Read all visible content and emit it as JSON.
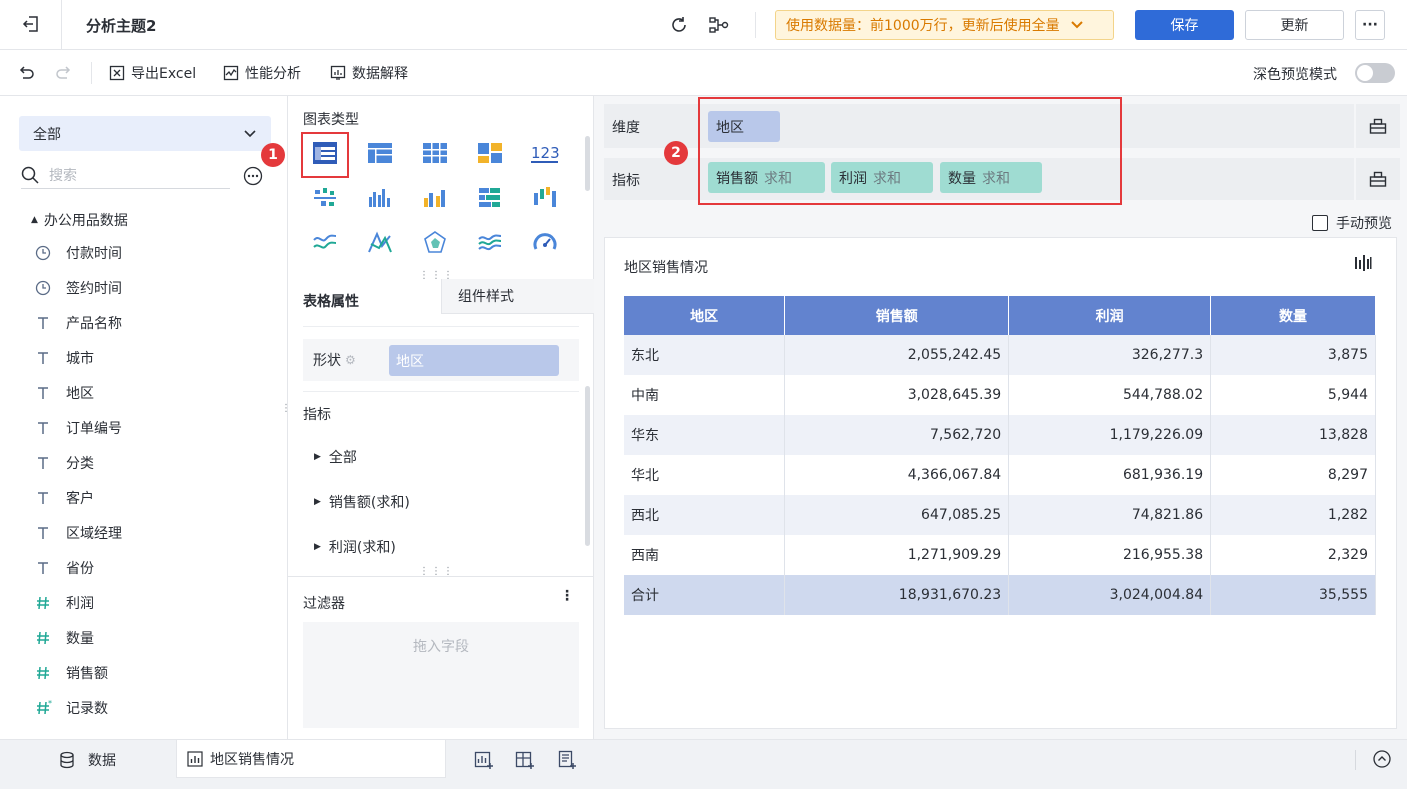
{
  "header": {
    "title": "分析主题2",
    "data_notice": "使用数据量：前1000万行，更新后使用全量",
    "save_label": "保存",
    "update_label": "更新",
    "more_label": "···"
  },
  "toolbar": {
    "export_label": "导出Excel",
    "performance_label": "性能分析",
    "explain_label": "数据解释",
    "dark_mode_label": "深色预览模式"
  },
  "left": {
    "dataset_select": "全部",
    "search_placeholder": "搜索",
    "folder": "办公用品数据",
    "fields": [
      {
        "name": "付款时间",
        "type": "time"
      },
      {
        "name": "签约时间",
        "type": "time"
      },
      {
        "name": "产品名称",
        "type": "text"
      },
      {
        "name": "城市",
        "type": "text"
      },
      {
        "name": "地区",
        "type": "text"
      },
      {
        "name": "订单编号",
        "type": "text"
      },
      {
        "name": "分类",
        "type": "text"
      },
      {
        "name": "客户",
        "type": "text"
      },
      {
        "name": "区域经理",
        "type": "text"
      },
      {
        "name": "省份",
        "type": "text"
      },
      {
        "name": "利润",
        "type": "number"
      },
      {
        "name": "数量",
        "type": "number"
      },
      {
        "name": "销售额",
        "type": "number"
      },
      {
        "name": "记录数",
        "type": "count"
      }
    ]
  },
  "middle": {
    "chart_type_label": "图表类型",
    "tab_table_props": "表格属性",
    "tab_component_style": "组件样式",
    "shape_label": "形状",
    "shape_value": "地区",
    "metrics_label": "指标",
    "metric_items": [
      "全部",
      "销售额(求和)",
      "利润(求和)"
    ],
    "filter_label": "过滤器",
    "filter_placeholder": "拖入字段"
  },
  "right": {
    "dimension_label": "维度",
    "dimension_value": "地区",
    "measure_label": "指标",
    "measures": [
      {
        "name": "销售额",
        "agg": "求和"
      },
      {
        "name": "利润",
        "agg": "求和"
      },
      {
        "name": "数量",
        "agg": "求和"
      }
    ],
    "manual_preview_label": "手动预览",
    "chart_title": "地区销售情况",
    "table": {
      "headers": [
        "地区",
        "销售额",
        "利润",
        "数量"
      ],
      "rows": [
        [
          "东北",
          "2,055,242.45",
          "326,277.3",
          "3,875"
        ],
        [
          "中南",
          "3,028,645.39",
          "544,788.02",
          "5,944"
        ],
        [
          "华东",
          "7,562,720",
          "1,179,226.09",
          "13,828"
        ],
        [
          "华北",
          "4,366,067.84",
          "681,936.19",
          "8,297"
        ],
        [
          "西北",
          "647,085.25",
          "74,821.86",
          "1,282"
        ],
        [
          "西南",
          "1,271,909.29",
          "216,955.38",
          "2,329"
        ]
      ],
      "total": [
        "合计",
        "18,931,670.23",
        "3,024,004.84",
        "35,555"
      ]
    }
  },
  "bottom": {
    "data_tab": "数据",
    "component_tab": "地区销售情况"
  },
  "annotations": {
    "badge1": "1",
    "badge2": "2",
    "color": "#e4393c"
  },
  "colors": {
    "primary": "#2f6bd8",
    "header_blue": "#6283cf",
    "dim_pill": "#b9c8ea",
    "measure_pill": "#9fdcd2",
    "teal": "#20a896"
  }
}
